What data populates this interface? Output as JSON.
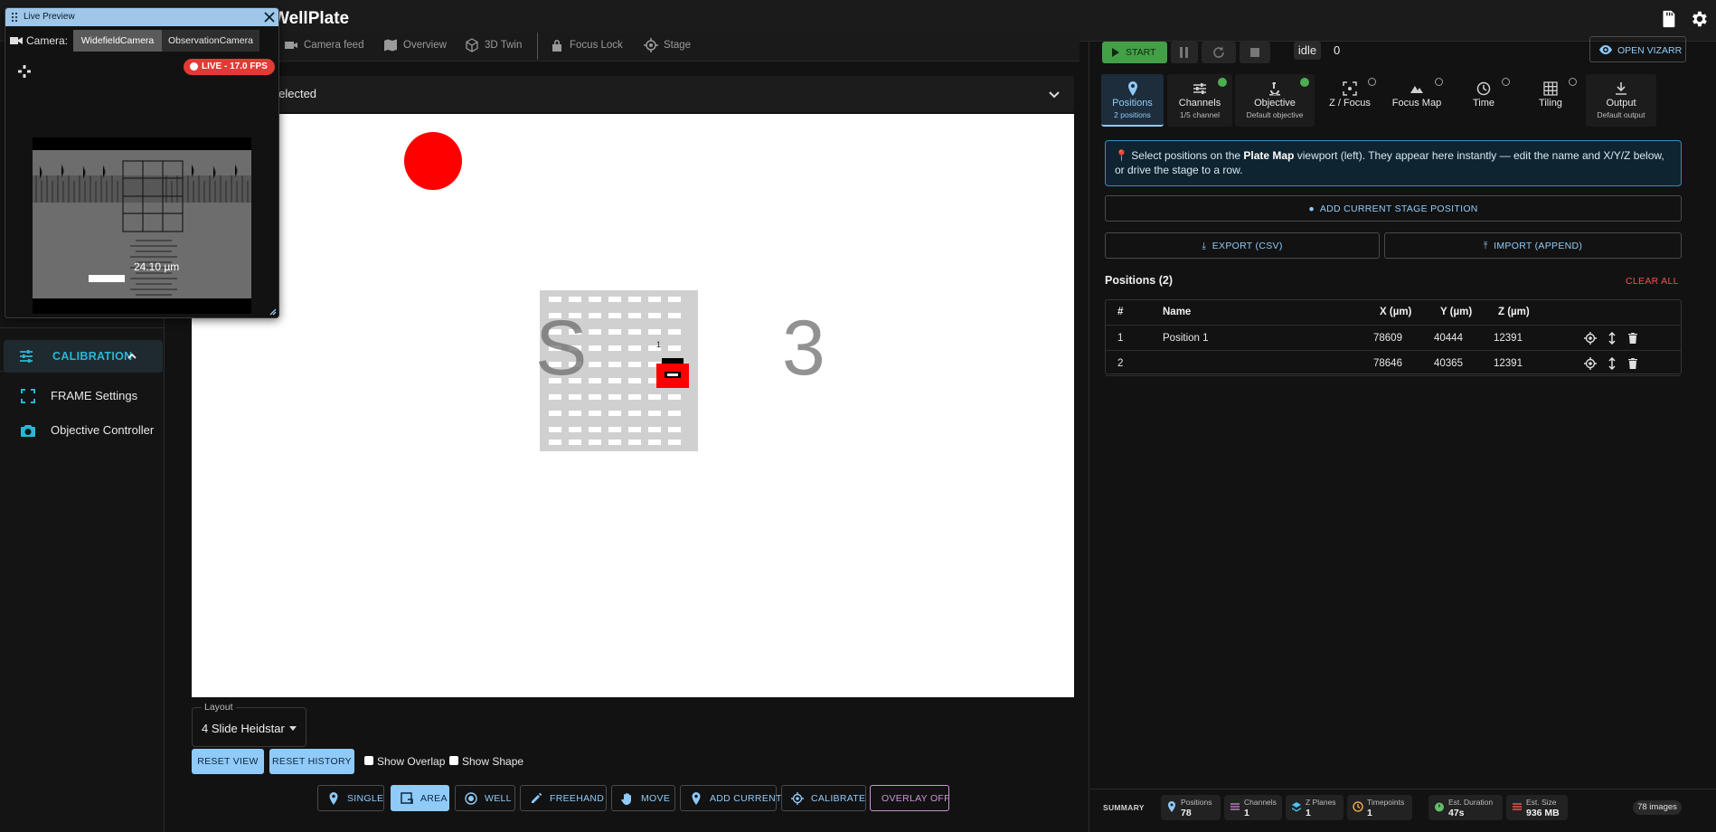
{
  "app": {
    "title": "WellPlate"
  },
  "live_preview": {
    "title": "Live Preview",
    "camera_label": "Camera:",
    "cameras": [
      "WidefieldCamera",
      "ObservationCamera"
    ],
    "active_camera": "WidefieldCamera",
    "live_status": "LIVE - 17.0 FPS",
    "scale_bar": "24.10 µm"
  },
  "sidebar": {
    "section_label": "CALIBRATION",
    "items": [
      {
        "label": "FRAME Settings",
        "icon": "crop-frame-icon"
      },
      {
        "label": "Objective Controller",
        "icon": "camera-icon"
      }
    ]
  },
  "center": {
    "tabs": [
      {
        "label": "Camera feed",
        "icon": "videocam-icon"
      },
      {
        "label": "Overview",
        "icon": "map-icon"
      },
      {
        "label": "3D Twin",
        "icon": "cube-icon"
      },
      {
        "label": "Focus Lock",
        "icon": "lock-icon"
      },
      {
        "label": "Stage",
        "icon": "crosshair-icon"
      }
    ],
    "accordion_title": "ons) – no plate selected",
    "plate_text": "S   3",
    "plate_marker": "1",
    "layout": {
      "legend": "Layout",
      "value": "4 Slide Heidstar"
    },
    "buttons": {
      "reset_view": "RESET VIEW",
      "reset_history": "RESET HISTORY"
    },
    "checkboxes": {
      "overlay": "Show Overlap",
      "shape": "Show Shape"
    },
    "tools": [
      {
        "label": "SINGLE",
        "icon": "pin-icon",
        "active": false
      },
      {
        "label": "AREA",
        "icon": "area-select-icon",
        "active": true
      },
      {
        "label": "WELL",
        "icon": "radio-target-icon",
        "active": false
      },
      {
        "label": "FREEHAND",
        "icon": "pen-icon",
        "active": false
      },
      {
        "label": "MOVE",
        "icon": "hand-icon",
        "active": false
      },
      {
        "label": "ADD CURRENT",
        "icon": "pin-icon",
        "active": false
      },
      {
        "label": "CALIBRATE",
        "icon": "gps-icon",
        "active": false
      },
      {
        "label": "OVERLAY OFF",
        "icon": "",
        "active": false
      }
    ]
  },
  "controls": {
    "start": "START",
    "state": "idle",
    "counter": "0",
    "open_vizarr": "OPEN VIZARR"
  },
  "steps": [
    {
      "title": "Positions",
      "sub": "2 positions",
      "icon": "pin-icon",
      "done": false,
      "active": true
    },
    {
      "title": "Channels",
      "sub": "1/5 channel",
      "icon": "sliders-icon",
      "done": true,
      "active": false
    },
    {
      "title": "Objective",
      "sub": "Default objective",
      "icon": "microscope-icon",
      "done": true,
      "active": false
    },
    {
      "title": "Z / Focus",
      "sub": "",
      "icon": "focus-icon",
      "done": false,
      "active": false
    },
    {
      "title": "Focus Map",
      "sub": "",
      "icon": "terrain-icon",
      "done": false,
      "active": false
    },
    {
      "title": "Time",
      "sub": "",
      "icon": "clock-icon",
      "done": false,
      "active": false
    },
    {
      "title": "Tiling",
      "sub": "",
      "icon": "grid-icon",
      "done": false,
      "active": false
    },
    {
      "title": "Output",
      "sub": "Default output",
      "icon": "download-icon",
      "done": false,
      "active": false
    }
  ],
  "info": {
    "pre": "Select positions on the ",
    "bold": "Plate Map",
    "post": " viewport (left). They appear here instantly — edit the name and X/Y/Z below, or drive the stage to a row."
  },
  "positions": {
    "add_current": "ADD CURRENT STAGE POSITION",
    "export": "EXPORT (CSV)",
    "import": "IMPORT (APPEND)",
    "heading": "Positions (2)",
    "clear_all": "CLEAR ALL",
    "columns": [
      "#",
      "Name",
      "X (µm)",
      "Y (µm)",
      "Z (µm)"
    ],
    "rows": [
      {
        "idx": "1",
        "name": "Position 1",
        "x": "78609",
        "y": "40444",
        "z": "12391"
      },
      {
        "idx": "2",
        "name": "",
        "x": "78646",
        "y": "40365",
        "z": "12391"
      }
    ]
  },
  "summary": {
    "label": "SUMMARY",
    "items": [
      {
        "key": "Positions",
        "val": "78",
        "color": "#90caf9"
      },
      {
        "key": "Channels",
        "val": "1",
        "color": "#ce93d8"
      },
      {
        "key": "Z Planes",
        "val": "1",
        "color": "#4fc3f7"
      },
      {
        "key": "Timepoints",
        "val": "1",
        "color": "#ffb74d"
      },
      {
        "key": "Est. Duration",
        "val": "47s",
        "color": "#66bb6a"
      },
      {
        "key": "Est. Size",
        "val": "936 MB",
        "color": "#ef5350"
      }
    ],
    "images": "78 images"
  }
}
